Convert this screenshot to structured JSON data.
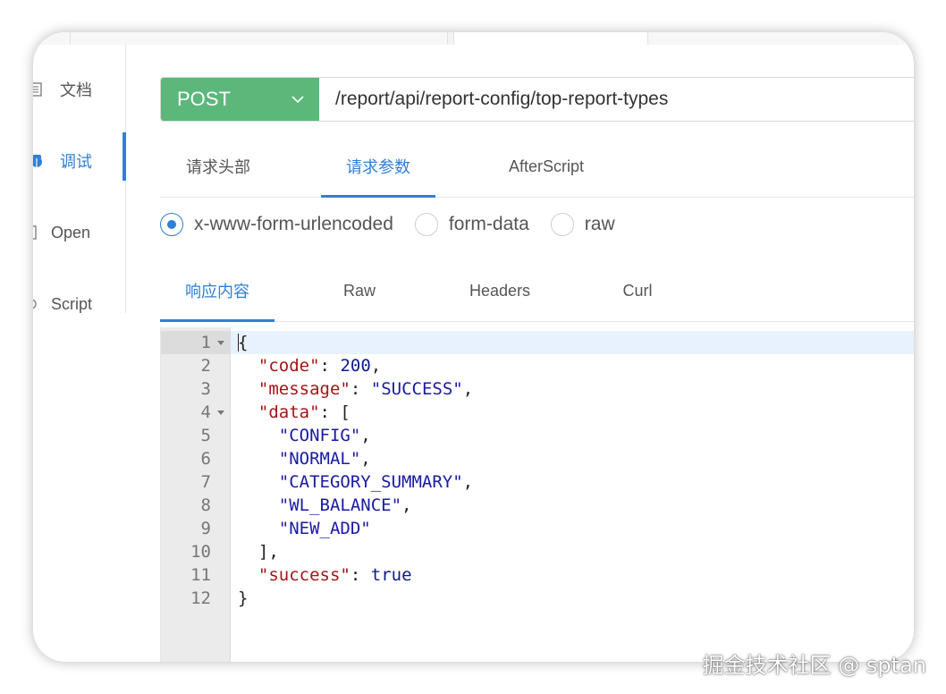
{
  "sidebar": {
    "items": [
      {
        "label": "文档",
        "icon": "document-icon"
      },
      {
        "label": "调试",
        "icon": "bug-icon"
      },
      {
        "label": "Open",
        "icon": "file-icon"
      },
      {
        "label": "Script",
        "icon": "gear-icon"
      }
    ],
    "active_index": 1
  },
  "request": {
    "method": "POST",
    "url": "/report/api/report-config/top-report-types"
  },
  "request_tabs": [
    {
      "label": "请求头部"
    },
    {
      "label": "请求参数"
    },
    {
      "label": "AfterScript"
    }
  ],
  "body_types": [
    {
      "label": "x-www-form-urlencoded",
      "checked": true
    },
    {
      "label": "form-data",
      "checked": false
    },
    {
      "label": "raw",
      "checked": false
    }
  ],
  "response_tabs": [
    {
      "label": "响应内容"
    },
    {
      "label": "Raw"
    },
    {
      "label": "Headers"
    },
    {
      "label": "Curl"
    }
  ],
  "response_lines": [
    {
      "n": "1",
      "text": "{"
    },
    {
      "n": "2",
      "text": "  \"code\": 200,"
    },
    {
      "n": "3",
      "text": "  \"message\": \"SUCCESS\","
    },
    {
      "n": "4",
      "text": "  \"data\": ["
    },
    {
      "n": "5",
      "text": "    \"CONFIG\","
    },
    {
      "n": "6",
      "text": "    \"NORMAL\","
    },
    {
      "n": "7",
      "text": "    \"CATEGORY_SUMMARY\","
    },
    {
      "n": "8",
      "text": "    \"WL_BALANCE\","
    },
    {
      "n": "9",
      "text": "    \"NEW_ADD\""
    },
    {
      "n": "10",
      "text": "  ],"
    },
    {
      "n": "11",
      "text": "  \"success\": true"
    },
    {
      "n": "12",
      "text": "}"
    }
  ],
  "watermark": "掘金技术社区 @ sptan",
  "colors": {
    "accent": "#2f80d6",
    "method_bg": "#5cb87a"
  }
}
